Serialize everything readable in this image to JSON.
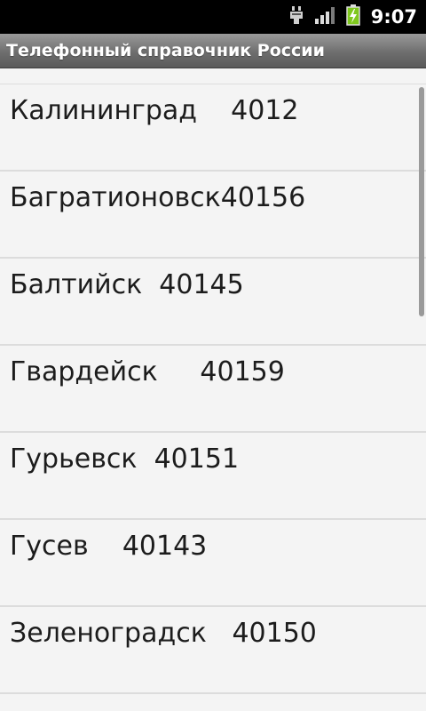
{
  "status_bar": {
    "time": "9:07",
    "icons": [
      "usb-debug-icon",
      "signal-icon",
      "battery-charging-icon"
    ],
    "battery_color": "#7fc81e"
  },
  "app": {
    "title": "Телефонный справочник России"
  },
  "list": {
    "items": [
      {
        "label": "Калининград    4012"
      },
      {
        "label": "Багратионовск40156"
      },
      {
        "label": "Балтийск  40145"
      },
      {
        "label": "Гвардейск     40159"
      },
      {
        "label": "Гурьевск  40151"
      },
      {
        "label": "Гусев    40143"
      },
      {
        "label": "Зеленоградск   40150"
      }
    ]
  }
}
